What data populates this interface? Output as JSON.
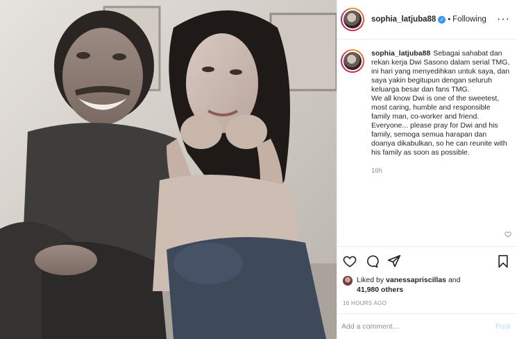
{
  "header": {
    "username": "sophia_latjuba88",
    "separator": "•",
    "follow_status": "Following",
    "more_icon": "more-options-icon"
  },
  "caption": {
    "username": "sophia_latjuba88",
    "paragraphs": [
      "Sebagai sahabat dan rekan kerja Dwi Sasono dalam serial TMG, ini hari yang menyedihkan untuk saya, dan saya yakin begitupun dengan seluruh keluarga besar dan fans TMG.",
      "We all know Dwi is one of the sweetest, most caring, humble and responsible family man, co-worker and friend.",
      "Everyone... please pray for Dwi and his family, semoga semua harapan dan doanya dikabulkan, so he can reunite with his family as soon as possible."
    ],
    "timestamp": "16h"
  },
  "actions": {
    "icons": [
      "heart-icon",
      "comment-icon",
      "share-icon",
      "bookmark-icon"
    ]
  },
  "likes": {
    "prefix": "Liked by",
    "user": "vanessapriscillas",
    "connector": "and",
    "others": "41,980 others"
  },
  "time_ago": "16 HOURS AGO",
  "comment_box": {
    "placeholder": "Add a comment…",
    "post_label": "Post"
  },
  "colors": {
    "accent": "#3897f0",
    "post_disabled": "#b2dffc",
    "muted": "#8e8e8e"
  }
}
